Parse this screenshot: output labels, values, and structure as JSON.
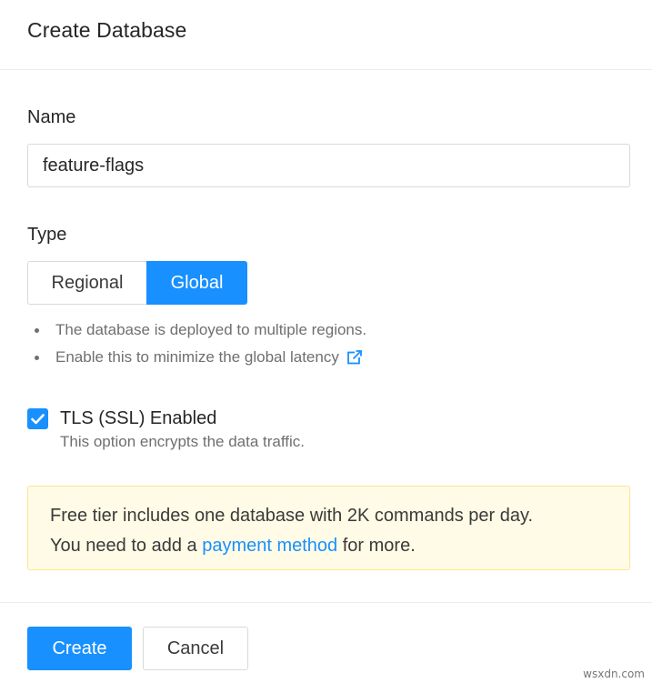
{
  "dialog": {
    "title": "Create Database"
  },
  "name_field": {
    "label": "Name",
    "value": "feature-flags"
  },
  "type_field": {
    "label": "Type",
    "options": [
      "Regional",
      "Global"
    ],
    "selected": "Global"
  },
  "type_help": [
    "The database is deployed to multiple regions.",
    "Enable this to minimize the global latency"
  ],
  "tls": {
    "checked": true,
    "label": "TLS (SSL) Enabled",
    "description": "This option encrypts the data traffic."
  },
  "notice": {
    "line1": "Free tier includes one database with 2K commands per day.",
    "line2_prefix": "You need to add a ",
    "link_text": "payment method",
    "line2_suffix": " for more."
  },
  "footer": {
    "create_label": "Create",
    "cancel_label": "Cancel"
  },
  "watermark": "wsxdn.com",
  "colors": {
    "accent": "#1890ff",
    "notice_bg": "#fffbe6",
    "notice_border": "#ffe58f"
  },
  "icons": {
    "external_link": "external-link-icon",
    "check": "checkmark-icon"
  }
}
